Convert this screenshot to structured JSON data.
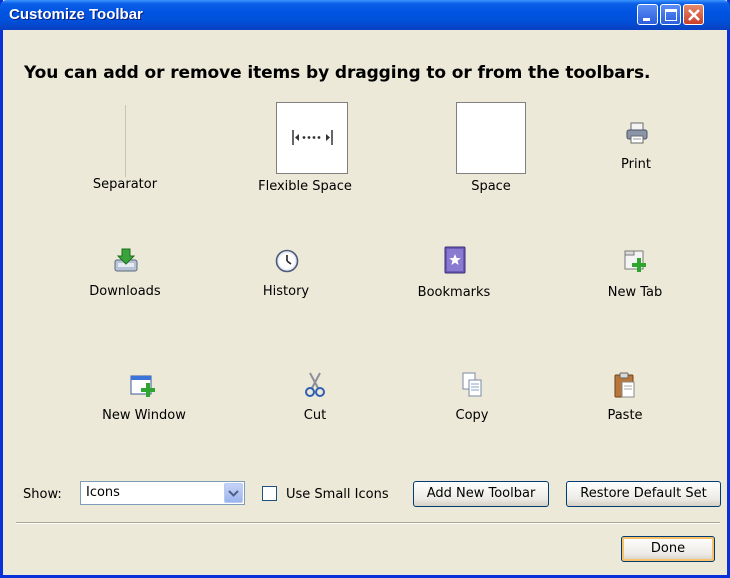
{
  "window": {
    "title": "Customize Toolbar",
    "controls": [
      "minimize",
      "maximize",
      "close"
    ]
  },
  "instructions": "You can add or remove items by dragging to or from the toolbars.",
  "items": [
    {
      "label": "Separator",
      "icon": "separator-icon"
    },
    {
      "label": "Flexible Space",
      "icon": "flexible-space-icon"
    },
    {
      "label": "Space",
      "icon": "space-icon"
    },
    {
      "label": "Print",
      "icon": "printer-icon"
    },
    {
      "label": "Downloads",
      "icon": "downloads-icon"
    },
    {
      "label": "History",
      "icon": "clock-icon"
    },
    {
      "label": "Bookmarks",
      "icon": "bookmarks-icon"
    },
    {
      "label": "New Tab",
      "icon": "new-tab-icon"
    },
    {
      "label": "New Window",
      "icon": "new-window-icon"
    },
    {
      "label": "Cut",
      "icon": "scissors-icon"
    },
    {
      "label": "Copy",
      "icon": "copy-icon"
    },
    {
      "label": "Paste",
      "icon": "paste-icon"
    }
  ],
  "controls": {
    "show_label": "Show:",
    "show_value": "Icons",
    "small_icons_label": "Use Small Icons",
    "small_icons_checked": false,
    "add_toolbar_label": "Add New Toolbar",
    "restore_label": "Restore Default Set",
    "done_label": "Done"
  },
  "colors": {
    "titlebar": "#0054e3",
    "window_bg": "#ece9d8",
    "close_button": "#c8402a"
  }
}
